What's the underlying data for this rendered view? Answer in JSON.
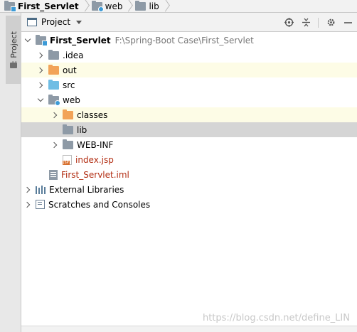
{
  "breadcrumb": {
    "items": [
      {
        "label": "First_Servlet",
        "icon": "module-folder-icon"
      },
      {
        "label": "web",
        "icon": "web-folder-icon"
      },
      {
        "label": "lib",
        "icon": "folder-icon"
      }
    ]
  },
  "toolstrip": {
    "tab_label": "1: Project"
  },
  "panel": {
    "title": "Project",
    "actions": [
      "locate-icon",
      "collapse-all-icon",
      "settings-gear-icon",
      "hide-icon"
    ]
  },
  "tree": {
    "root": {
      "label": "First_Servlet",
      "path": "F:\\Spring-Boot Case\\First_Servlet"
    },
    "idea": {
      "label": ".idea"
    },
    "out": {
      "label": "out"
    },
    "src": {
      "label": "src"
    },
    "web": {
      "label": "web"
    },
    "classes": {
      "label": "classes"
    },
    "lib": {
      "label": "lib"
    },
    "webinf": {
      "label": "WEB-INF"
    },
    "indexjsp": {
      "label": "index.jsp",
      "badge": "JSP"
    },
    "iml": {
      "label": "First_Servlet.iml"
    },
    "extlibs": {
      "label": "External Libraries"
    },
    "scratches": {
      "label": "Scratches and Consoles"
    }
  },
  "watermark": {
    "text": "https://blog.csdn.net/define_LIN"
  },
  "colors": {
    "highlight_row": "#fdfce6",
    "selected_row": "#d5d5d5",
    "excluded_folder": "#f2a358",
    "source_folder": "#6fbde4",
    "modified_file": "#b22d12"
  }
}
